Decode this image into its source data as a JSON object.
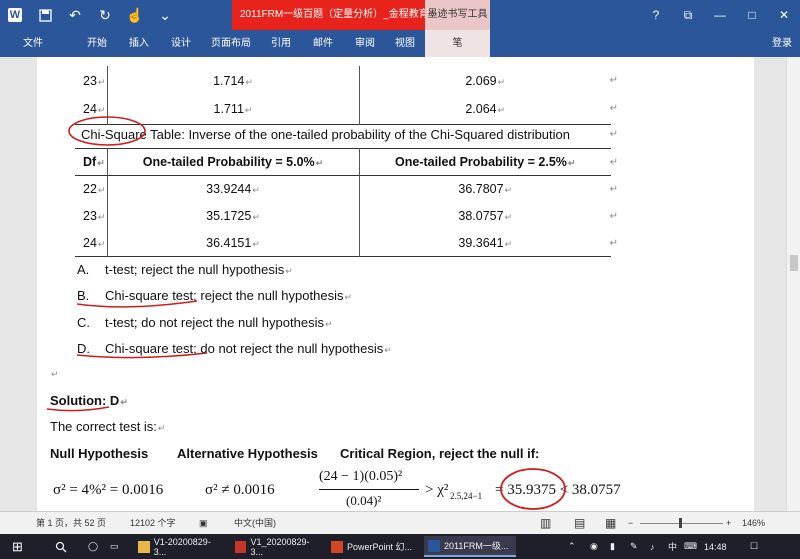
{
  "titlebar": {
    "doc_title": "2011FRM一级百题（定量分析）_金程教育 [...",
    "context_tool": "墨迹书写工具",
    "win_help": "?",
    "win_restore_ribbon": "⧉",
    "win_min": "—",
    "win_max": "□",
    "win_close": "✕"
  },
  "ribbon": {
    "tabs": [
      "文件",
      "开始",
      "插入",
      "设计",
      "页面布局",
      "引用",
      "邮件",
      "审阅",
      "视图",
      "笔"
    ],
    "login": "登录"
  },
  "document": {
    "t_rows": [
      {
        "df": "23",
        "p5": "1.714",
        "p25": "2.069"
      },
      {
        "df": "24",
        "p5": "1.711",
        "p25": "2.064"
      }
    ],
    "caption_a": "Chi-Square Table",
    "caption_b": ": Inverse of the one-tailed probability of the Chi-Squared distribution",
    "chi_table": {
      "headers": [
        "Df",
        "One-tailed Probability = 5.0%",
        "One-tailed Probability = 2.5%"
      ],
      "rows": [
        {
          "df": "22",
          "p5": "33.9244",
          "p25": "36.7807"
        },
        {
          "df": "23",
          "p5": "35.1725",
          "p25": "38.0757"
        },
        {
          "df": "24",
          "p5": "36.4151",
          "p25": "39.3641"
        }
      ]
    },
    "options": [
      {
        "letter": "A.",
        "text": "t-test; reject the null hypothesis"
      },
      {
        "letter": "B.",
        "text": "Chi-square test; reject the null hypothesis"
      },
      {
        "letter": "C.",
        "text": "t-test; do not reject the null hypothesis"
      },
      {
        "letter": "D.",
        "text": "Chi-square test; do not reject the null hypothesis"
      }
    ],
    "solution": "Solution: D",
    "correct_test": "The correct test is:",
    "hyp_null": "Null Hypothesis",
    "hyp_alt": "Alternative Hypothesis",
    "hyp_crit": "Critical Region, reject the null if:",
    "f_null": "σ² = 4%² = 0.0016",
    "f_alt": "σ² ≠ 0.0016",
    "f_num": "(24 − 1)(0.05)²",
    "f_den": "(0.04)²",
    "f_gt": "> χ²",
    "f_sub": "2.5,24−1",
    "f_eq": "= 35.9375 < 38.0757"
  },
  "statusbar": {
    "page": "第 1 页，共 52 页",
    "words": "12102 个字",
    "lang": "中文(中国)",
    "zoom": "146%"
  },
  "taskbar": {
    "apps": [
      "V1-20200829-3...",
      "V1_20200829-3...",
      "PowerPoint 幻...",
      "2011FRM一级..."
    ],
    "ime": "中",
    "time": "14:48"
  }
}
